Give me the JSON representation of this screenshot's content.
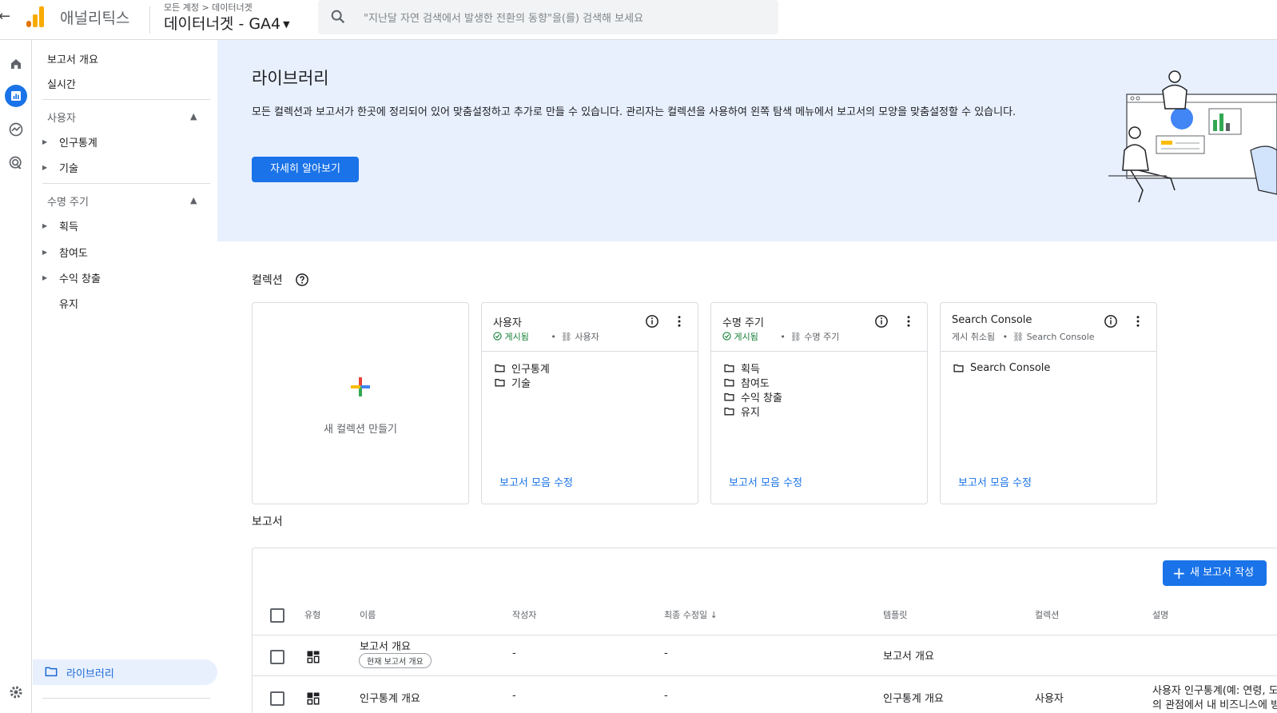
{
  "header": {
    "back_icon": "arrow-left-icon",
    "app_name": "애널리틱스",
    "breadcrumb": "모든 계정 > 데이터너겟",
    "property": "데이터너겟 - GA4",
    "search_placeholder": "\"지난달 자연 검색에서 발생한 전환의 동향\"을(를) 검색해 보세요"
  },
  "rail": {
    "icons": [
      "home-icon",
      "reports-icon",
      "explore-icon",
      "advertising-icon",
      "settings-icon"
    ]
  },
  "nav": {
    "overview": "보고서 개요",
    "realtime": "실시간",
    "users_section": "사용자",
    "demographics": "인구통계",
    "tech": "기술",
    "lifecycle_section": "수명 주기",
    "acquisition": "획득",
    "engagement": "참여도",
    "monetization": "수익 창출",
    "retention": "유지",
    "library": "라이브러리"
  },
  "hero": {
    "title": "라이브러리",
    "description": "모든 컬렉션과 보고서가 한곳에 정리되어 있어 맞춤설정하고 추가로 만들 수 있습니다. 관리자는 컬렉션을 사용하여 왼쪽 탐색 메뉴에서 보고서의 모양을 맞춤설정할 수 있습니다.",
    "learn_more": "자세히 알아보기"
  },
  "collections": {
    "heading": "컬렉션",
    "new_label": "새 컬렉션 만들기",
    "edit_label": "보고서 모음 수정",
    "cards": [
      {
        "title": "사용자",
        "status": "게시됨",
        "template": "사용자",
        "items": [
          "인구통계",
          "기술"
        ]
      },
      {
        "title": "수명 주기",
        "status": "게시됨",
        "template": "수명 주기",
        "items": [
          "획득",
          "참여도",
          "수익 창출",
          "유지"
        ]
      },
      {
        "title": "Search Console",
        "status": "게시 취소됨",
        "template": "Search Console",
        "items": [
          "Search Console"
        ]
      }
    ]
  },
  "reports": {
    "heading": "보고서",
    "new_button": "새 보고서 작성",
    "columns": {
      "type": "유형",
      "name": "이름",
      "creator": "작성자",
      "modified": "최종 수정일",
      "template": "템플릿",
      "collection": "컬렉션",
      "description": "설명"
    },
    "rows": [
      {
        "name": "보고서 개요",
        "chip": "현재 보고서 개요",
        "creator": "-",
        "modified": "-",
        "template": "보고서 개요",
        "collection": "",
        "description": ""
      },
      {
        "name": "인구통계 개요",
        "chip": "",
        "creator": "-",
        "modified": "-",
        "template": "인구통계 개요",
        "collection": "사용자",
        "description": "사용자 인구통계(예: 연령, 도",
        "description2": "의 관점에서 내 비즈니스에 방"
      }
    ]
  },
  "colors": {
    "accent": "#1a73e8",
    "hero_bg": "#e8f0fe",
    "published": "#188038"
  }
}
